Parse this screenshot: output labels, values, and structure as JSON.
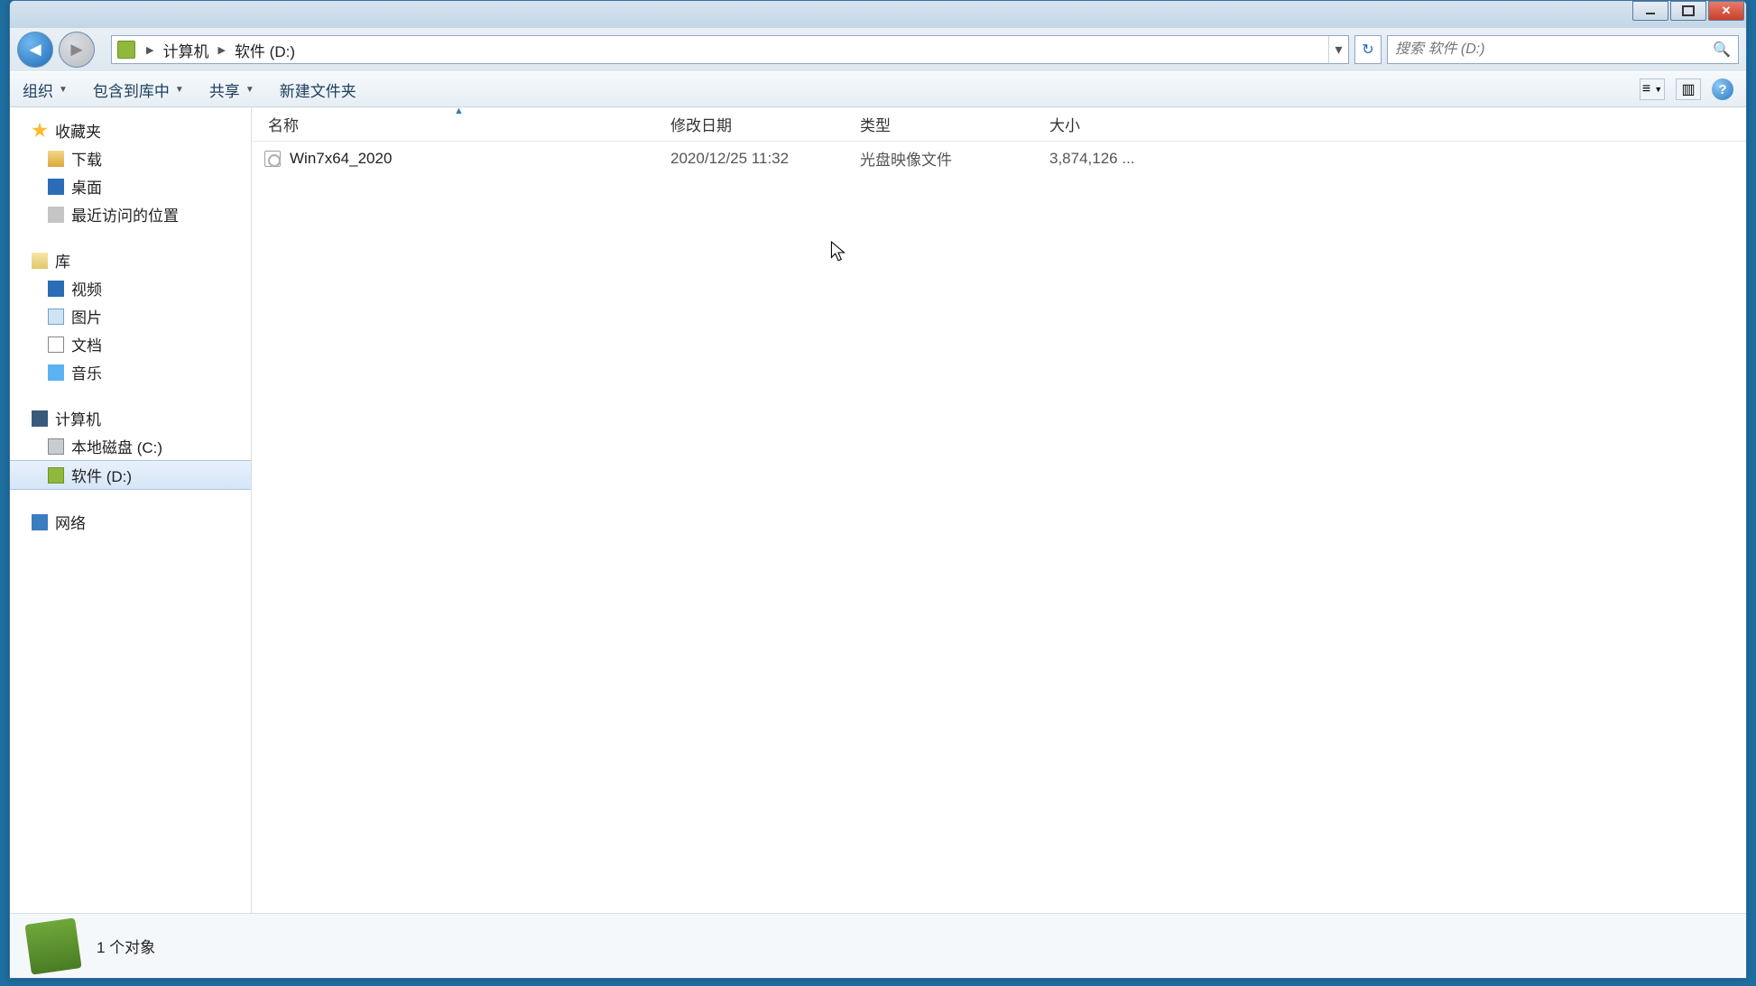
{
  "breadcrumb": {
    "p1": "计算机",
    "p2": "软件 (D:)"
  },
  "search": {
    "placeholder": "搜索 软件 (D:)"
  },
  "toolbar": {
    "organize": "组织",
    "include": "包含到库中",
    "share": "共享",
    "newfolder": "新建文件夹"
  },
  "columns": {
    "name": "名称",
    "date": "修改日期",
    "type": "类型",
    "size": "大小"
  },
  "sidebar": {
    "favorites": "收藏夹",
    "downloads": "下载",
    "desktop": "桌面",
    "recent": "最近访问的位置",
    "libraries": "库",
    "videos": "视频",
    "pictures": "图片",
    "documents": "文档",
    "music": "音乐",
    "computer": "计算机",
    "driveC": "本地磁盘 (C:)",
    "driveD": "软件 (D:)",
    "network": "网络"
  },
  "files": [
    {
      "name": "Win7x64_2020",
      "date": "2020/12/25 11:32",
      "type": "光盘映像文件",
      "size": "3,874,126 ..."
    }
  ],
  "status": {
    "count": "1 个对象"
  }
}
